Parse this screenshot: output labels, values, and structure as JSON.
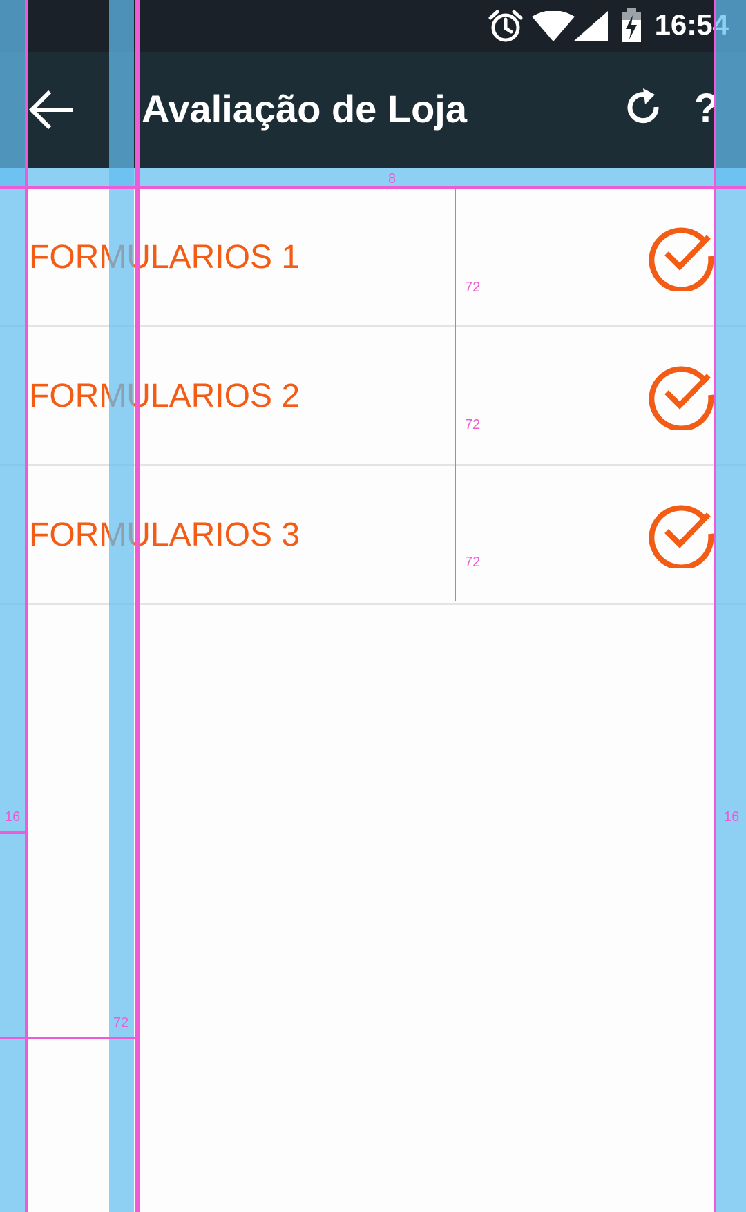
{
  "status_bar": {
    "time": "16:54",
    "icons": [
      "alarm-icon",
      "wifi-icon",
      "signal-icon",
      "battery-charging-icon"
    ]
  },
  "app_bar": {
    "title": "Avaliação de Loja",
    "back_icon": "arrow-back-icon",
    "refresh_icon": "refresh-icon",
    "help_label": "?"
  },
  "list": {
    "items": [
      {
        "label": "FORMULARIOS 1",
        "status_icon": "check-circle-icon"
      },
      {
        "label": "FORMULARIOS 2",
        "status_icon": "check-circle-icon"
      },
      {
        "label": "FORMULARIOS 3",
        "status_icon": "check-circle-icon"
      }
    ]
  },
  "guides": {
    "labels": [
      "8",
      "72",
      "72",
      "72",
      "16",
      "16",
      "72"
    ]
  },
  "colors": {
    "status_bar": "#1b2128",
    "app_bar": "#1c2d35",
    "accent": "#f35c14",
    "divider": "#e4e4e4",
    "guide_fill": "#62bcf0",
    "guide_line": "#ee5bd6"
  }
}
